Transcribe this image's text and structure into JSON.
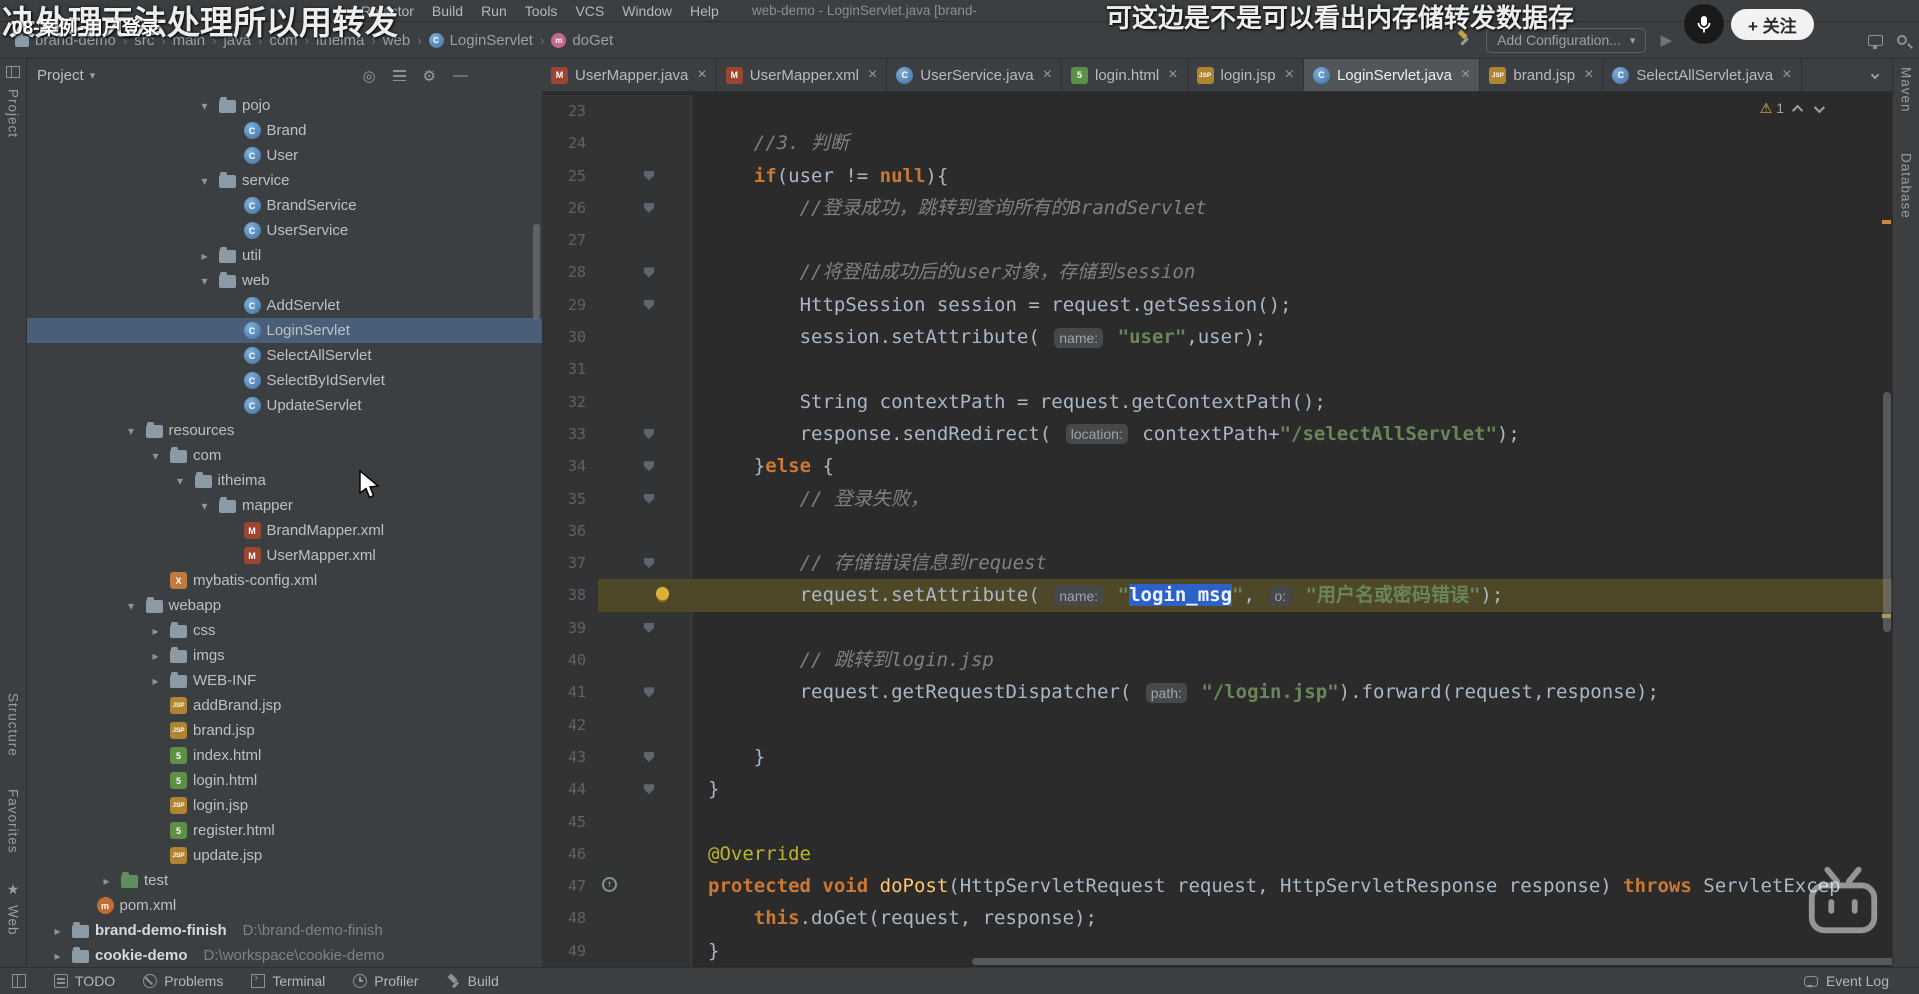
{
  "overlay": {
    "danmaku_left": "决处理无法处理所以用转发",
    "danmaku_right": "可这边是不是可以看出内存储转发数据存",
    "video_title": "08-案例-用户登录",
    "follow_label": "+ 关注"
  },
  "titlebar": {
    "menus": [
      "Refactor",
      "Build",
      "Run",
      "Tools",
      "VCS",
      "Window",
      "Help"
    ],
    "window_title": "web-demo - LoginServlet.java [brand-"
  },
  "toolbar": {
    "breadcrumbs": [
      {
        "label": "brand-demo",
        "icon": "folder"
      },
      {
        "label": "src"
      },
      {
        "label": "main"
      },
      {
        "label": "java"
      },
      {
        "label": "com"
      },
      {
        "label": "itheima"
      },
      {
        "label": "web"
      },
      {
        "label": "LoginServlet",
        "icon": "class"
      },
      {
        "label": "doGet",
        "icon": "method"
      }
    ],
    "add_configuration": "Add Configuration..."
  },
  "tabs": [
    {
      "label": "UserMapper.java",
      "icon": "mapper"
    },
    {
      "label": "UserMapper.xml",
      "icon": "mapper"
    },
    {
      "label": "UserService.java",
      "icon": "class"
    },
    {
      "label": "login.html",
      "icon": "html"
    },
    {
      "label": "login.jsp",
      "icon": "jsp"
    },
    {
      "label": "LoginServlet.java",
      "icon": "class",
      "selected": true
    },
    {
      "label": "brand.jsp",
      "icon": "jsp"
    },
    {
      "label": "SelectAllServlet.java",
      "icon": "class"
    }
  ],
  "project_panel": {
    "title": "Project",
    "tree": [
      {
        "i": 7,
        "ch": "down",
        "icon": "folder",
        "label": "pojo"
      },
      {
        "i": 8,
        "icon": "class",
        "label": "Brand"
      },
      {
        "i": 8,
        "icon": "class",
        "label": "User"
      },
      {
        "i": 7,
        "ch": "down",
        "icon": "folder",
        "label": "service"
      },
      {
        "i": 8,
        "icon": "class",
        "label": "BrandService"
      },
      {
        "i": 8,
        "icon": "class",
        "label": "UserService"
      },
      {
        "i": 7,
        "ch": "right",
        "icon": "folder",
        "label": "util"
      },
      {
        "i": 7,
        "ch": "down",
        "icon": "folder",
        "label": "web"
      },
      {
        "i": 8,
        "icon": "class",
        "label": "AddServlet"
      },
      {
        "i": 8,
        "icon": "class",
        "label": "LoginServlet",
        "selected": true
      },
      {
        "i": 8,
        "icon": "class",
        "label": "SelectAllServlet"
      },
      {
        "i": 8,
        "icon": "class",
        "label": "SelectByIdServlet"
      },
      {
        "i": 8,
        "icon": "class",
        "label": "UpdateServlet"
      },
      {
        "i": 4,
        "ch": "down",
        "icon": "folder",
        "label": "resources"
      },
      {
        "i": 5,
        "ch": "down",
        "icon": "folder",
        "label": "com"
      },
      {
        "i": 6,
        "ch": "down",
        "icon": "folder",
        "label": "itheima"
      },
      {
        "i": 7,
        "ch": "down",
        "icon": "folder",
        "label": "mapper"
      },
      {
        "i": 8,
        "icon": "mapper",
        "label": "BrandMapper.xml"
      },
      {
        "i": 8,
        "icon": "mapper",
        "label": "UserMapper.xml"
      },
      {
        "i": 5,
        "icon": "xml",
        "label": "mybatis-config.xml"
      },
      {
        "i": 4,
        "ch": "down",
        "icon": "folder",
        "label": "webapp"
      },
      {
        "i": 5,
        "ch": "right",
        "icon": "folder",
        "label": "css"
      },
      {
        "i": 5,
        "ch": "right",
        "icon": "folder",
        "label": "imgs"
      },
      {
        "i": 5,
        "ch": "right",
        "icon": "folder",
        "label": "WEB-INF"
      },
      {
        "i": 5,
        "icon": "jsp",
        "label": "addBrand.jsp"
      },
      {
        "i": 5,
        "icon": "jsp",
        "label": "brand.jsp"
      },
      {
        "i": 5,
        "icon": "html",
        "label": "index.html"
      },
      {
        "i": 5,
        "icon": "html",
        "label": "login.html"
      },
      {
        "i": 5,
        "icon": "jsp",
        "label": "login.jsp"
      },
      {
        "i": 5,
        "icon": "html",
        "label": "register.html"
      },
      {
        "i": 5,
        "icon": "jsp",
        "label": "update.jsp"
      },
      {
        "i": 3,
        "ch": "right",
        "icon": "folder-test",
        "label": "test"
      },
      {
        "i": 2,
        "icon": "maven",
        "label": "pom.xml"
      },
      {
        "i": 1,
        "ch": "right",
        "icon": "folder",
        "label": "brand-demo-finish",
        "bold": true,
        "path": "D:\\brand-demo-finish"
      },
      {
        "i": 1,
        "ch": "right",
        "icon": "folder",
        "label": "cookie-demo",
        "bold": true,
        "path": "D:\\workspace\\cookie-demo"
      }
    ]
  },
  "editor": {
    "inspection_count": "1",
    "lines": [
      {
        "n": 23,
        "ind": 0,
        "segs": []
      },
      {
        "n": 24,
        "ind": 1,
        "segs": [
          [
            "c",
            "//3. 判断"
          ]
        ]
      },
      {
        "n": 25,
        "ind": 1,
        "g": "fold",
        "segs": [
          [
            "k",
            "if"
          ],
          [
            "p",
            "(user != "
          ],
          [
            "k",
            "null"
          ],
          [
            "p",
            "){"
          ]
        ]
      },
      {
        "n": 26,
        "ind": 2,
        "g": "fold",
        "segs": [
          [
            "c",
            "//登录成功，跳转到查询所有的BrandServlet"
          ]
        ]
      },
      {
        "n": 27,
        "ind": 0,
        "segs": []
      },
      {
        "n": 28,
        "ind": 2,
        "g": "fold",
        "segs": [
          [
            "c",
            "//将登陆成功后的user对象，存储到session"
          ]
        ]
      },
      {
        "n": 29,
        "ind": 2,
        "g": "fold",
        "segs": [
          [
            "p",
            "HttpSession session = request.getSession();"
          ]
        ]
      },
      {
        "n": 30,
        "ind": 2,
        "segs": [
          [
            "p",
            "session.setAttribute( "
          ],
          [
            "h",
            "name:"
          ],
          [
            "p",
            " "
          ],
          [
            "s",
            "\"user\""
          ],
          [
            "p",
            ",user);"
          ]
        ]
      },
      {
        "n": 31,
        "ind": 0,
        "segs": []
      },
      {
        "n": 32,
        "ind": 2,
        "segs": [
          [
            "p",
            "String contextPath = request.getContextPath();"
          ]
        ]
      },
      {
        "n": 33,
        "ind": 2,
        "g": "fold",
        "segs": [
          [
            "p",
            "response.sendRedirect( "
          ],
          [
            "h",
            "location:"
          ],
          [
            "p",
            " contextPath+"
          ],
          [
            "s",
            "\"/selectAllServlet\""
          ],
          [
            "p",
            ");"
          ]
        ]
      },
      {
        "n": 34,
        "ind": 1,
        "g": "fold",
        "segs": [
          [
            "p",
            "}"
          ],
          [
            "k",
            "else"
          ],
          [
            "p",
            " {"
          ]
        ]
      },
      {
        "n": 35,
        "ind": 2,
        "g": "fold",
        "segs": [
          [
            "c",
            "// 登录失败，"
          ]
        ]
      },
      {
        "n": 36,
        "ind": 0,
        "segs": []
      },
      {
        "n": 37,
        "ind": 2,
        "g": "fold",
        "segs": [
          [
            "c",
            "// 存储错误信息到request"
          ]
        ]
      },
      {
        "n": 38,
        "ind": 2,
        "g": "bulb",
        "hl": true,
        "segs": [
          [
            "p",
            "request.setAttribute( "
          ],
          [
            "h",
            "name:"
          ],
          [
            "p",
            " "
          ],
          [
            "s",
            "\""
          ],
          [
            "sel",
            "login_msg"
          ],
          [
            "s",
            "\""
          ],
          [
            "p",
            ", "
          ],
          [
            "h",
            "o:"
          ],
          [
            "p",
            " "
          ],
          [
            "s",
            "\"用户名或密码错误\""
          ],
          [
            "p",
            ");"
          ]
        ]
      },
      {
        "n": 39,
        "ind": 0,
        "g": "fold",
        "segs": []
      },
      {
        "n": 40,
        "ind": 2,
        "segs": [
          [
            "c",
            "// 跳转到login.jsp"
          ]
        ]
      },
      {
        "n": 41,
        "ind": 2,
        "g": "fold",
        "segs": [
          [
            "p",
            "request.getRequestDispatcher( "
          ],
          [
            "h",
            "path:"
          ],
          [
            "p",
            " "
          ],
          [
            "s",
            "\"/login.jsp\""
          ],
          [
            "p",
            ").forward(request,response);"
          ]
        ]
      },
      {
        "n": 42,
        "ind": 0,
        "segs": []
      },
      {
        "n": 43,
        "ind": 1,
        "g": "fold",
        "segs": [
          [
            "p",
            "}"
          ]
        ]
      },
      {
        "n": 44,
        "ind": 0,
        "g": "fold",
        "segs": [
          [
            "p",
            "}"
          ]
        ]
      },
      {
        "n": 45,
        "ind": 0,
        "segs": []
      },
      {
        "n": 46,
        "ind": 0,
        "segs": [
          [
            "a",
            "@Override"
          ]
        ]
      },
      {
        "n": 47,
        "ind": 0,
        "g": "override",
        "segs": [
          [
            "k",
            "protected"
          ],
          [
            "p",
            " "
          ],
          [
            "k",
            "void"
          ],
          [
            "p",
            " "
          ],
          [
            "m",
            "doPost"
          ],
          [
            "p",
            "(HttpServletRequest request, HttpServletResponse response) "
          ],
          [
            "k",
            "throws"
          ],
          [
            "p",
            " ServletExcep"
          ]
        ]
      },
      {
        "n": 48,
        "ind": 1,
        "segs": [
          [
            "k",
            "this"
          ],
          [
            "p",
            ".doGet(request, response);"
          ]
        ]
      },
      {
        "n": 49,
        "ind": 0,
        "segs": [
          [
            "p",
            "}"
          ]
        ]
      }
    ]
  },
  "statusbar": {
    "items": [
      {
        "label": "TODO",
        "icon": "todo"
      },
      {
        "label": "Problems",
        "icon": "problems"
      },
      {
        "label": "Terminal",
        "icon": "terminal"
      },
      {
        "label": "Profiler",
        "icon": "profiler"
      },
      {
        "label": "Build",
        "icon": "build"
      }
    ],
    "right": {
      "label": "Event Log"
    }
  },
  "stripes": {
    "left": [
      "Project",
      "Structure",
      "Favorites",
      "Web"
    ],
    "right": [
      "Maven",
      "Database"
    ]
  }
}
